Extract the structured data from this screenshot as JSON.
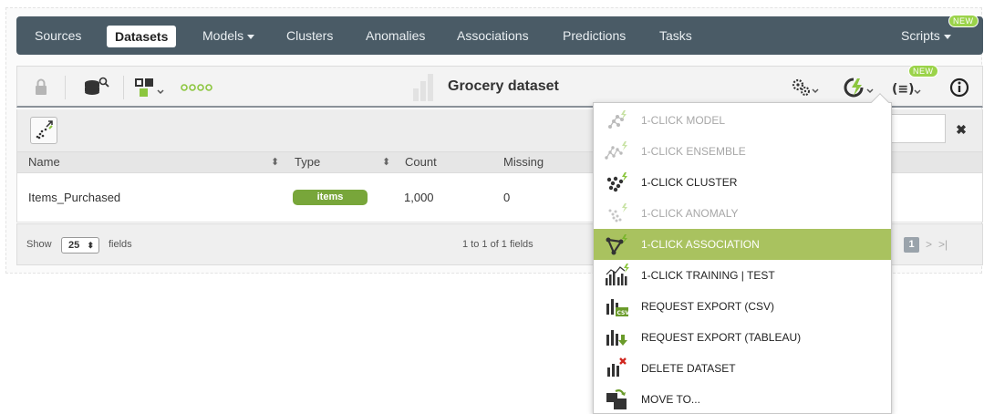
{
  "nav": {
    "items": [
      "Sources",
      "Datasets",
      "Models",
      "Clusters",
      "Anomalies",
      "Associations",
      "Predictions",
      "Tasks"
    ],
    "active": "Datasets",
    "scripts_label": "Scripts",
    "new_badge": "NEW"
  },
  "toolbar": {
    "title": "Grocery dataset",
    "new_badge": "NEW"
  },
  "table": {
    "headers": {
      "name": "Name",
      "type": "Type",
      "count": "Count",
      "missing": "Missing"
    },
    "rows": [
      {
        "name": "Items_Purchased",
        "type": "items",
        "count": "1,000",
        "missing": "0"
      }
    ]
  },
  "footer": {
    "show_label": "Show",
    "page_size": "25",
    "fields_label": "fields",
    "range_text": "1 to 1 of 1 fields",
    "current_page": "1"
  },
  "menu": {
    "items": [
      {
        "label": "1-CLICK MODEL",
        "icon": "model-icon",
        "disabled": true
      },
      {
        "label": "1-CLICK ENSEMBLE",
        "icon": "ensemble-icon",
        "disabled": true
      },
      {
        "label": "1-CLICK CLUSTER",
        "icon": "cluster-icon",
        "disabled": false
      },
      {
        "label": "1-CLICK ANOMALY",
        "icon": "anomaly-icon",
        "disabled": true
      },
      {
        "label": "1-CLICK ASSOCIATION",
        "icon": "association-icon",
        "disabled": false,
        "highlighted": true
      },
      {
        "label": "1-CLICK TRAINING | TEST",
        "icon": "training-test-icon",
        "disabled": false
      },
      {
        "label": "REQUEST EXPORT (CSV)",
        "icon": "export-csv-icon",
        "disabled": false
      },
      {
        "label": "REQUEST EXPORT (TABLEAU)",
        "icon": "export-tableau-icon",
        "disabled": false
      },
      {
        "label": "DELETE DATASET",
        "icon": "delete-dataset-icon",
        "disabled": false
      },
      {
        "label": "MOVE TO...",
        "icon": "move-to-icon",
        "disabled": false
      }
    ]
  },
  "colors": {
    "nav_bg": "#4a5b66",
    "highlight": "#a9c25f",
    "type_badge": "#78a63a",
    "new_badge": "#9bd34a",
    "lightning": "#8cc63f"
  }
}
